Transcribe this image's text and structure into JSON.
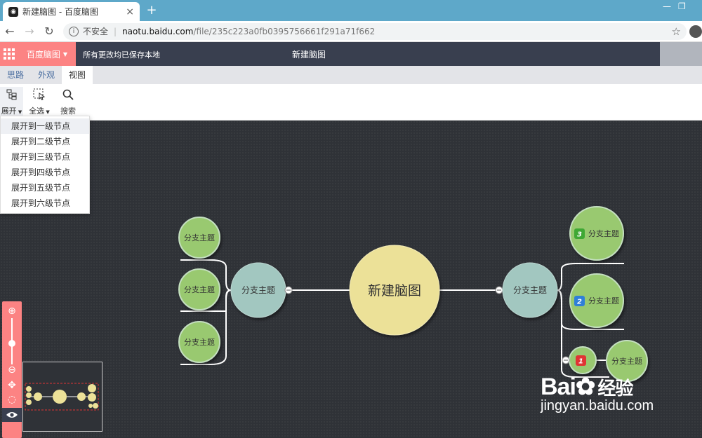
{
  "browser": {
    "tab_title": "新建脑图 - 百度脑图",
    "tab_close": "×",
    "new_tab": "+",
    "insecure_label": "不安全",
    "url_host": "naotu.baidu.com",
    "url_path": "/file/235c223a0fb0395756661f291a71f662"
  },
  "app": {
    "brand": "百度脑图",
    "saved_status": "所有更改均已保存本地",
    "doc_title": "新建脑图"
  },
  "menu_tabs": [
    {
      "label": "思路",
      "active": false
    },
    {
      "label": "外观",
      "active": false
    },
    {
      "label": "视图",
      "active": true
    }
  ],
  "toolbar": {
    "expand_label": "展开",
    "select_all_label": "全选",
    "search_label": "搜索"
  },
  "expand_menu": [
    "展开到一级节点",
    "展开到二级节点",
    "展开到三级节点",
    "展开到四级节点",
    "展开到五级节点",
    "展开到六级节点"
  ],
  "mindmap": {
    "root": "新建脑图",
    "branch_left": "分支主题",
    "branch_right": "分支主题",
    "left_children": [
      "分支主题",
      "分支主题",
      "分支主题"
    ],
    "right_children": [
      {
        "label": "分支主题",
        "priority": "3",
        "priority_color": "#3fa834"
      },
      {
        "label": "分支主题",
        "priority": "2",
        "priority_color": "#2f7fd8"
      },
      {
        "label": "分支主题",
        "priority": "1",
        "priority_color": "#e03434"
      }
    ],
    "colors": {
      "root": "#ece198",
      "branch": "#a2c7c0",
      "leaf": "#99c96f",
      "line": "#ffffff"
    }
  },
  "watermark": {
    "brand": "Bai",
    "brand_suffix": "经验",
    "url": "jingyan.baidu.com"
  },
  "colors": {
    "accent": "#fc8383",
    "header": "#393f4f",
    "canvas": "#2f3237"
  }
}
